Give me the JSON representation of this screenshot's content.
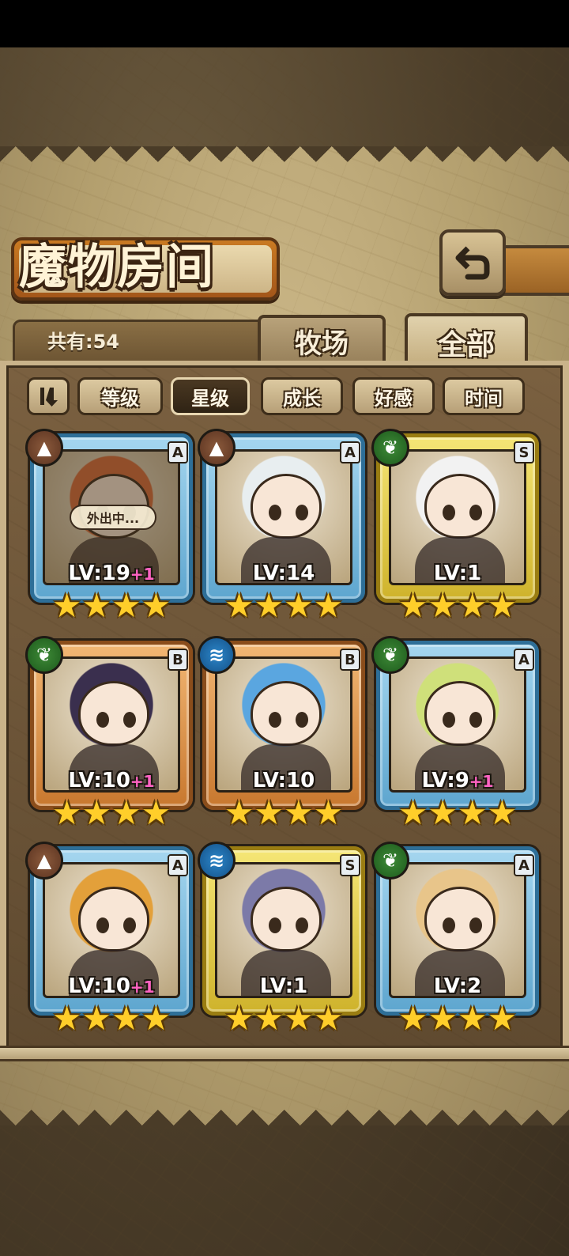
{
  "header": {
    "title": "魔物房间"
  },
  "summary": {
    "count_label": "共有:54"
  },
  "tabs": {
    "ranch": "牧场",
    "all": "全部"
  },
  "sort": {
    "options": [
      "等级",
      "星级",
      "成长",
      "好感",
      "时间"
    ],
    "active": "星级"
  },
  "colors": {
    "frame_blue": "#5ea6cf",
    "frame_gold": "#cfb32c",
    "frame_orange": "#c8782f",
    "plus": "#ff63c3",
    "star": "#ffce2a"
  },
  "cards": [
    {
      "element": "rock",
      "rank": "A",
      "level": "LV:19",
      "bonus": "+1",
      "stars": "★★★★",
      "frame": "blue",
      "status": "外出中...",
      "hair": "#d86a3a"
    },
    {
      "element": "rock",
      "rank": "A",
      "level": "LV:14",
      "bonus": "",
      "stars": "★★★★",
      "frame": "blue",
      "status": "",
      "hair": "#e8eef0"
    },
    {
      "element": "leaf",
      "rank": "S",
      "level": "LV:1",
      "bonus": "",
      "stars": "★★★★",
      "frame": "gold",
      "status": "",
      "hair": "#f2f2f2"
    },
    {
      "element": "leaf",
      "rank": "B",
      "level": "LV:10",
      "bonus": "+1",
      "stars": "★★★★",
      "frame": "orange",
      "status": "",
      "hair": "#3a2f4e"
    },
    {
      "element": "water",
      "rank": "B",
      "level": "LV:10",
      "bonus": "",
      "stars": "★★★★",
      "frame": "orange",
      "status": "",
      "hair": "#5aa6e0"
    },
    {
      "element": "leaf",
      "rank": "A",
      "level": "LV:9",
      "bonus": "+1",
      "stars": "★★★★",
      "frame": "blue",
      "status": "",
      "hair": "#cfe07a"
    },
    {
      "element": "rock",
      "rank": "A",
      "level": "LV:10",
      "bonus": "+1",
      "stars": "★★★★",
      "frame": "blue",
      "status": "",
      "hair": "#e3a03a"
    },
    {
      "element": "water",
      "rank": "S",
      "level": "LV:1",
      "bonus": "",
      "stars": "★★★★",
      "frame": "gold",
      "status": "",
      "hair": "#7c7aa8"
    },
    {
      "element": "leaf",
      "rank": "A",
      "level": "LV:2",
      "bonus": "",
      "stars": "★★★★",
      "frame": "blue",
      "status": "",
      "hair": "#e8c58a"
    }
  ]
}
